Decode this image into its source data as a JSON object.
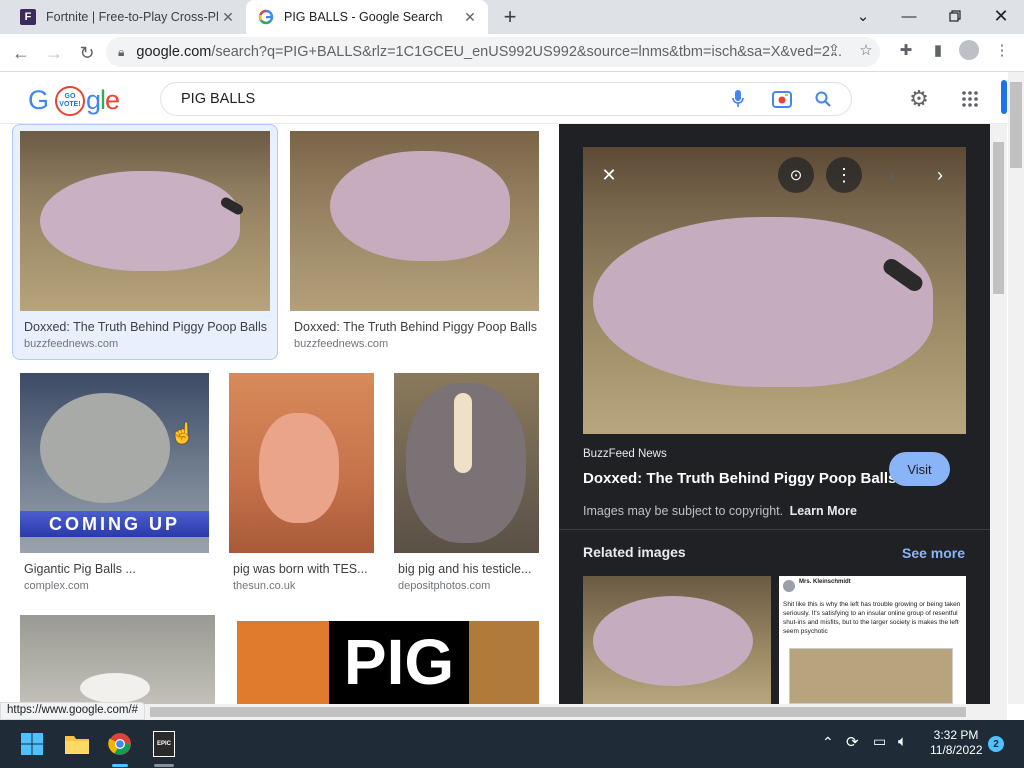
{
  "browser": {
    "tabs": [
      {
        "title": "Fortnite | Free-to-Play Cross-Plat",
        "favicon": "fortnite-favicon",
        "active": false
      },
      {
        "title": "PIG BALLS - Google Search",
        "favicon": "google-favicon",
        "active": true
      }
    ],
    "url_host": "google.com",
    "url_rest": "/search?q=PIG+BALLS&rlz=1C1GCEU_enUS992US992&source=lnms&tbm=isch&sa=X&ved=2..."
  },
  "google": {
    "logo_badge": "GO VOTE!",
    "query": "PIG BALLS"
  },
  "results": [
    {
      "caption": "Doxxed: The Truth Behind Piggy Poop Balls",
      "source": "buzzfeednews.com",
      "selected": true
    },
    {
      "caption": "Doxxed: The Truth Behind Piggy Poop Balls",
      "source": "buzzfeednews.com",
      "selected": false
    },
    {
      "caption": "Gigantic Pig Balls ...",
      "source": "complex.com",
      "overlay_text": "COMING UP"
    },
    {
      "caption": "pig was born with TES...",
      "source": "thesun.co.uk"
    },
    {
      "caption": "big pig and his testicle...",
      "source": "depositphotos.com"
    },
    {
      "caption": "",
      "source": ""
    },
    {
      "caption": "",
      "source": "",
      "overlay_text": "PIG"
    }
  ],
  "panel": {
    "source_name": "BuzzFeed News",
    "title": "Doxxed: The Truth Behind Piggy Poop Balls",
    "visit_label": "Visit",
    "copyright_text": "Images may be subject to copyright.",
    "learn_more": "Learn More",
    "related_heading": "Related images",
    "see_more": "See more",
    "tweet": {
      "author": "Mrs. Kleinschmidt",
      "text": "Shit like this is why the left has trouble growing or being taken seriously. It's satisfying to an insular online group of resentful shut-ins and misfits, but to the larger society is makes the left seem psychotic"
    }
  },
  "status_url": "https://www.google.com/#",
  "taskbar": {
    "time": "3:32 PM",
    "date": "11/8/2022",
    "notification_count": "2"
  },
  "colors": {
    "google_blue": "#4285f4",
    "google_red": "#ea4335",
    "google_yellow": "#fbbc05",
    "google_green": "#34a853",
    "panel_bg": "#202124",
    "link_blue": "#8ab4f8",
    "taskbar_bg": "#1f2c38"
  }
}
